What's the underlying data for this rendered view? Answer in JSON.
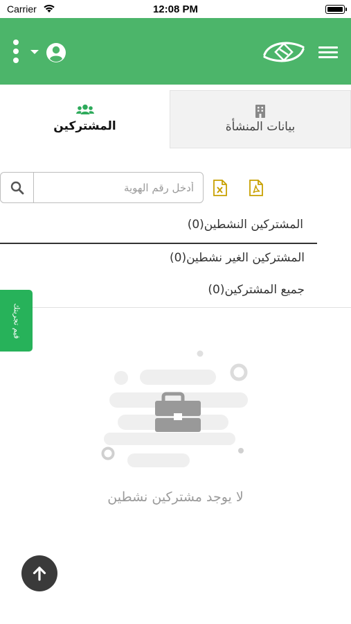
{
  "status_bar": {
    "carrier": "Carrier",
    "time": "12:08 PM"
  },
  "header": {
    "background": "#4cb56a",
    "icons": [
      "more-vertical-icon",
      "chevron-down-icon",
      "user-avatar-icon",
      "brand-logo",
      "hamburger-menu-icon"
    ]
  },
  "tabs": [
    {
      "label": "المشتركين",
      "icon": "users-icon",
      "active": true
    },
    {
      "label": "بيانات المنشأة",
      "icon": "building-icon",
      "active": false
    }
  ],
  "search": {
    "placeholder": "أدخل رقم الهوية",
    "value": ""
  },
  "export": {
    "icons": [
      "excel-export-icon",
      "pdf-export-icon"
    ],
    "color": "#c8a000"
  },
  "filters": [
    {
      "label": "المشتركين النشطين(0)",
      "active": true
    },
    {
      "label": "المشتركين الغير نشطين(0)",
      "active": false
    },
    {
      "label": "جميع المشتركين(0)",
      "active": false
    }
  ],
  "side_tab": {
    "label": "قيم تجربتك",
    "color": "#27b25a"
  },
  "empty_state": {
    "icon": "briefcase-icon",
    "message": "لا يوجد مشتركين نشطين"
  },
  "scroll_top": {
    "icon": "arrow-up-icon"
  }
}
